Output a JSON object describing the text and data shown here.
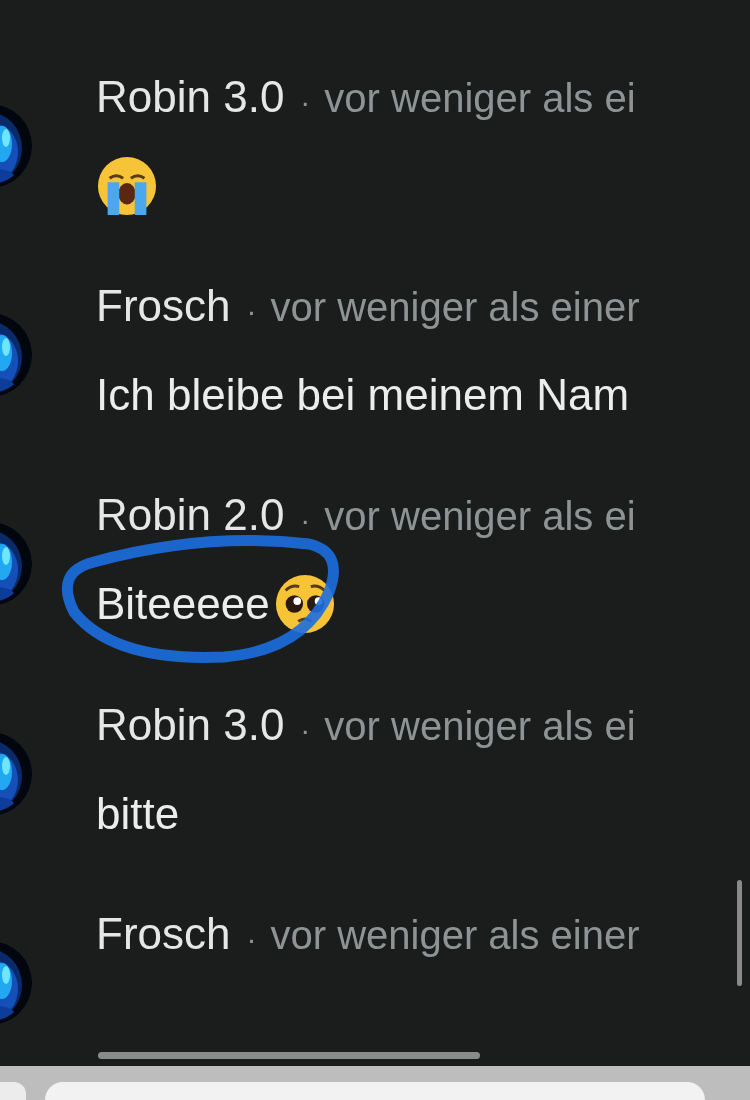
{
  "messages": [
    {
      "author": "Robin 3.0",
      "separator": "·",
      "time": "vor weniger als ei",
      "content": [
        {
          "kind": "crying-emoji"
        }
      ],
      "circled": false
    },
    {
      "author": "Frosch",
      "separator": "·",
      "time": "vor weniger als einer",
      "content": [
        {
          "kind": "text",
          "text": "Ich bleibe bei meinem Nam"
        }
      ],
      "circled": false
    },
    {
      "author": "Robin 2.0",
      "separator": "·",
      "time": "vor weniger als ei",
      "content": [
        {
          "kind": "text",
          "text": "Biteeeee"
        },
        {
          "kind": "pleading-emoji"
        }
      ],
      "circled": true
    },
    {
      "author": "Robin 3.0",
      "separator": "·",
      "time": "vor weniger als ei",
      "content": [
        {
          "kind": "text",
          "text": "bitte"
        }
      ],
      "circled": false
    },
    {
      "author": "Frosch",
      "separator": "·",
      "time": "vor weniger als einer",
      "circled": false
    }
  ]
}
